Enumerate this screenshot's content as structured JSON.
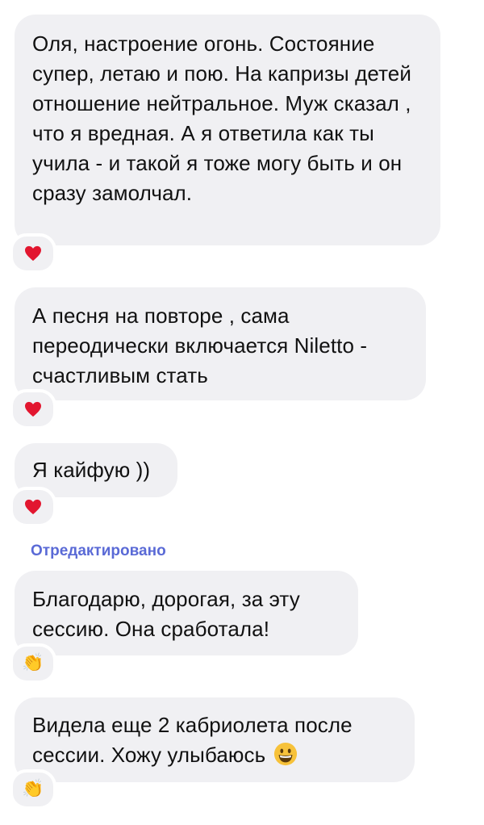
{
  "messages": [
    {
      "text": "Оля, настроение огонь. Состояние супер, летаю и пою. На капризы детей отношение нейтральное. Муж сказал , что я вредная. А я ответила как ты учила - и такой я тоже могу быть и он сразу замолчал.",
      "reaction": "heart"
    },
    {
      "text": "А песня на повторе , сама переодически включается Niletto - счастливым стать",
      "reaction": "heart"
    },
    {
      "text": "Я кайфую ))",
      "reaction": "heart"
    },
    {
      "edited_label": "Отредактировано",
      "text": "Благодарю, дорогая, за эту сессию. Она сработала!",
      "reaction": "clapping-hands"
    },
    {
      "text": "Видела еще 2 кабриолета после сессии. Хожу улыбаюсь",
      "emoji": "grinning-face",
      "reaction": "clapping-hands"
    }
  ],
  "colors": {
    "bubble": "#f0f0f3",
    "text": "#111111",
    "edited": "#5a6ad6",
    "heart": "#e2162f",
    "emoji_yellow": "#f7c23a"
  }
}
